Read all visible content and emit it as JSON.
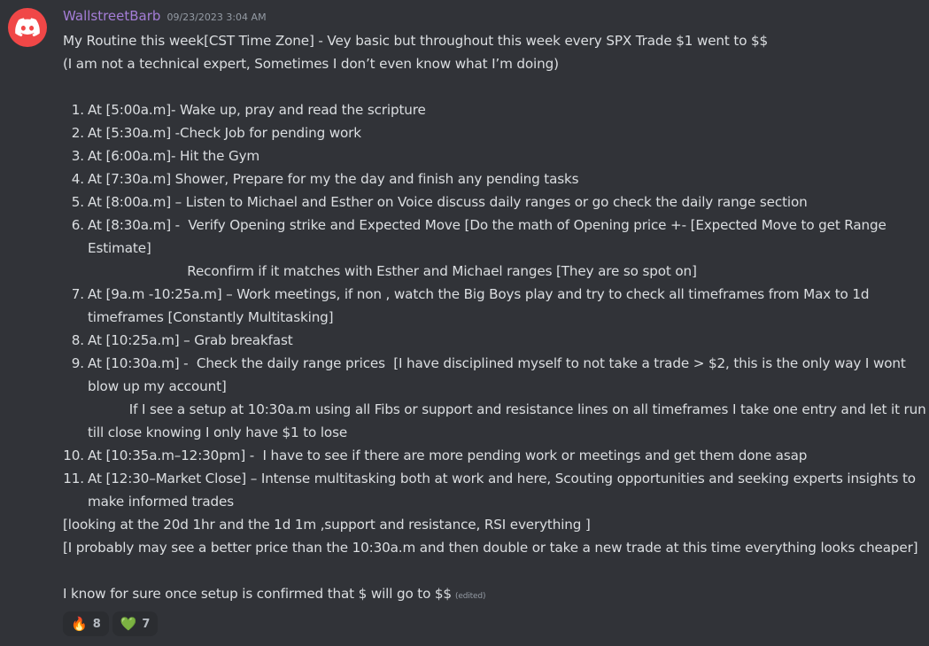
{
  "message": {
    "username": "WallstreetBarb",
    "timestamp": "09/23/2023 3:04 AM",
    "intro": [
      "My Routine this week[CST Time Zone] - Vey basic but throughout this week every SPX Trade $1 went to $$",
      "(I am not a technical expert, Sometimes I don’t even know what I’m doing)"
    ],
    "items": [
      {
        "num": "1.",
        "lines": [
          "At [5:00a.m]- Wake up, pray and read the scripture"
        ]
      },
      {
        "num": "2.",
        "lines": [
          "At [5:30a.m] -Check Job for pending work"
        ]
      },
      {
        "num": "3.",
        "lines": [
          "At [6:00a.m]- Hit the Gym"
        ]
      },
      {
        "num": "4.",
        "lines": [
          "At [7:30a.m] Shower, Prepare for my the day and finish any pending tasks"
        ]
      },
      {
        "num": "5.",
        "lines": [
          "At [8:00a.m] – Listen to Michael and Esther on Voice discuss daily ranges or go check the daily range section"
        ]
      },
      {
        "num": "6.",
        "lines": [
          "At [8:30a.m] -  Verify Opening strike and Expected Move [Do the math of Opening price +- [Expected Move to get Range",
          "Estimate]",
          "                        Reconfirm if it matches with Esther and Michael ranges [They are so spot on]"
        ]
      },
      {
        "num": "7.",
        "lines": [
          "At [9a.m -10:25a.m] – Work meetings, if non , watch the Big Boys play and try to check all timeframes from Max to 1d",
          "timeframes [Constantly Multitasking]"
        ]
      },
      {
        "num": "8.",
        "lines": [
          "At [10:25a.m] – Grab breakfast"
        ]
      },
      {
        "num": "9.",
        "lines": [
          "At [10:30a.m] -  Check the daily range prices  [I have disciplined myself to not take a trade > $2, this is the only way I wont",
          "blow up my account]",
          "          If I see a setup at 10:30a.m using all Fibs or support and resistance lines on all timeframes I take one entry and let it run",
          "till close knowing I only have $1 to lose"
        ]
      },
      {
        "num": "10.",
        "lines": [
          "At [10:35a.m–12:30pm] -  I have to see if there are more pending work or meetings and get them done asap"
        ]
      },
      {
        "num": "11.",
        "lines": [
          "At [12:30–Market Close] – Intense multitasking both at work and here, Scouting opportunities and seeking experts insights to",
          "make informed trades"
        ]
      }
    ],
    "notes": [
      "[looking at the 20d 1hr and the 1d 1m ,support and resistance, RSI everything ]",
      "[I probably may see a better price than the 10:30a.m and then double or take a new trade at this time everything looks cheaper]"
    ],
    "closing": "I know for sure once setup is confirmed that $ will go to $$",
    "edited_label": "(edited)"
  },
  "reactions": [
    {
      "emoji": "🔥",
      "icon": "fire-icon",
      "count": "8"
    },
    {
      "emoji": "💚",
      "icon": "green-heart-icon",
      "count": "7"
    }
  ],
  "colors": {
    "background": "#313338",
    "username": "#a47dd6",
    "avatar": "#f04747"
  }
}
